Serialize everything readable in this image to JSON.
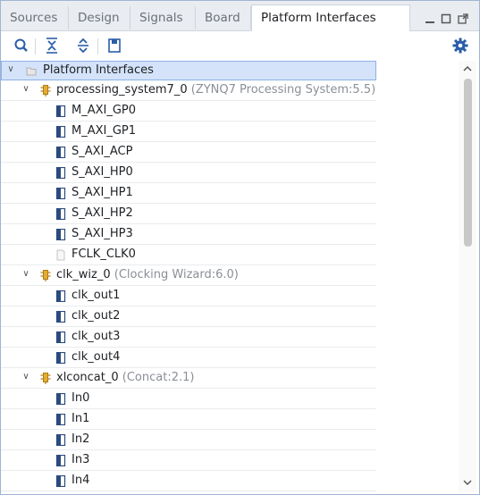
{
  "tabs": [
    {
      "label": "Sources"
    },
    {
      "label": "Design"
    },
    {
      "label": "Signals"
    },
    {
      "label": "Board"
    },
    {
      "label": "Platform Interfaces"
    }
  ],
  "tree": {
    "root": {
      "label": "Platform Interfaces"
    },
    "groups": [
      {
        "name": "processing_system7_0",
        "desc": "(ZYNQ7 Processing System:5.5)",
        "items": [
          "M_AXI_GP0",
          "M_AXI_GP1",
          "S_AXI_ACP",
          "S_AXI_HP0",
          "S_AXI_HP1",
          "S_AXI_HP2",
          "S_AXI_HP3",
          "FCLK_CLK0"
        ]
      },
      {
        "name": "clk_wiz_0",
        "desc": "(Clocking Wizard:6.0)",
        "items": [
          "clk_out1",
          "clk_out2",
          "clk_out3",
          "clk_out4"
        ]
      },
      {
        "name": "xlconcat_0",
        "desc": "(Concat:2.1)",
        "items": [
          "In0",
          "In1",
          "In2",
          "In3",
          "In4"
        ]
      }
    ]
  },
  "icons": {
    "close": "close-icon",
    "minimize": "minimize-icon",
    "maximize": "maximize-icon",
    "restore": "restore-icon",
    "search": "search-icon",
    "collapse_all": "collapse-all-icon",
    "expand_all": "expand-all-icon",
    "save": "save-icon",
    "settings": "gear-icon"
  },
  "colors": {
    "selection": "#d4e3f9",
    "accent": "#2a5ea8",
    "component_icon": "#d9a22b"
  }
}
